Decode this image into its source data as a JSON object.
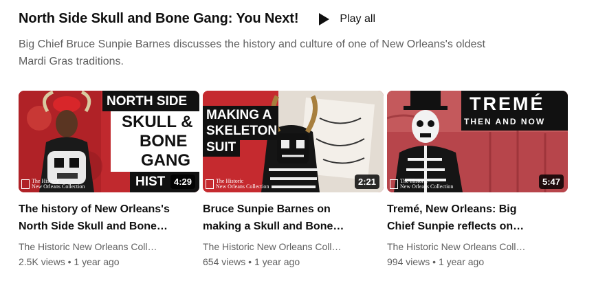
{
  "shelf": {
    "title": "North Side Skull and Bone Gang: You Next!",
    "play_all_label": "Play all",
    "play_icon": "play-triangle-icon",
    "description_line1": "Big Chief Bruce Sunpie Barnes discusses the history and culture of one of New Orleans's oldest",
    "description_line2": "Mardi Gras traditions."
  },
  "videos": [
    {
      "title_line1": "The history of New Orleans's",
      "title_line2": "North Side Skull and Bone…",
      "channel": "The Historic New Orleans Coll…",
      "views": "2.5K views",
      "age": "1 year ago",
      "duration": "4:29",
      "thumb_text": [
        "NORTH SIDE",
        "SKULL &",
        "BONE",
        "GANG",
        "HIST"
      ],
      "watermark": [
        "The Historic",
        "New Orleans Collection"
      ]
    },
    {
      "title_line1": "Bruce Sunpie Barnes on",
      "title_line2": "making a Skull and Bone…",
      "channel": "The Historic New Orleans Coll…",
      "views": "654 views",
      "age": "1 year ago",
      "duration": "2:21",
      "thumb_text": [
        "MAKING A",
        "SKELETON",
        "SUIT"
      ],
      "watermark": [
        "The Historic",
        "New Orleans Collection"
      ]
    },
    {
      "title_line1": "Tremé, New Orleans: Big",
      "title_line2": "Chief Sunpie reflects on…",
      "channel": "The Historic New Orleans Coll…",
      "views": "994 views",
      "age": "1 year ago",
      "duration": "5:47",
      "thumb_text": [
        "TREMÉ",
        "THEN AND NOW"
      ],
      "watermark": [
        "The Historic",
        "New Orleans Collection"
      ]
    }
  ],
  "separator": "•",
  "colors": {
    "accent_red": "#b8262b",
    "text_primary": "#0f0f0f",
    "text_secondary": "#606060"
  }
}
